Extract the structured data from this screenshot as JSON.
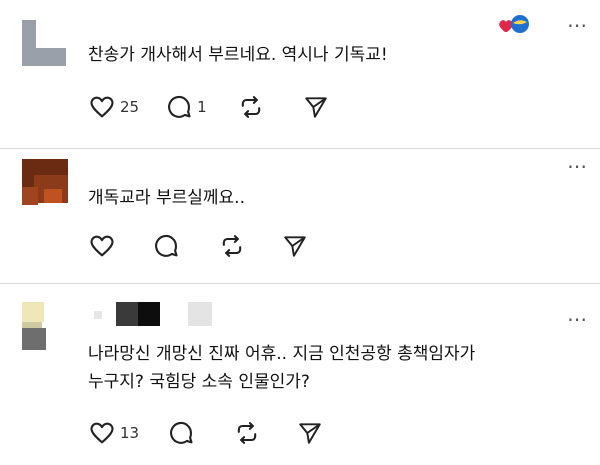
{
  "posts": [
    {
      "text_lines": [
        "찬송가 개사해서 부르네요. 역시나 기독교!"
      ],
      "like_count": "25",
      "reply_count": "1",
      "repost_count": "",
      "more_icon": "more-dots-icon"
    },
    {
      "text_lines": [
        "개독교라 부르실께요.."
      ],
      "like_count": "",
      "reply_count": "",
      "repost_count": "",
      "more_icon": "more-dots-icon"
    },
    {
      "text_lines": [
        "나라망신 개망신 진짜 어휴.. 지금 인천공항 총책임자가",
        "누구지? 국힘당 소속 인물인가?"
      ],
      "like_count": "13",
      "reply_count": "",
      "repost_count": "",
      "more_icon": "more-dots-icon"
    }
  ],
  "colors": {
    "heart_badge": "#e0284a",
    "blue_badge": "#1f6fd1",
    "divider": "#dcdcdc",
    "icon": "#222222"
  },
  "icons": [
    "heart-icon",
    "comment-icon",
    "repost-icon",
    "send-icon",
    "more-dots-icon"
  ]
}
